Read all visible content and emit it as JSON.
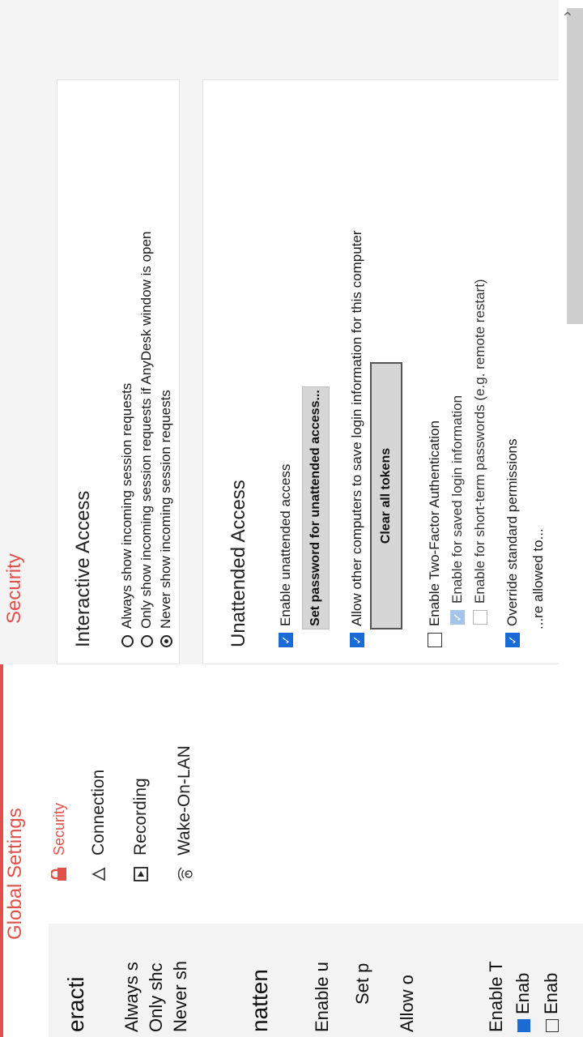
{
  "background": {
    "left_rows": [
      "eracti",
      "Always s",
      "Only shc",
      "Never sh",
      "natten",
      "Enable u",
      "Set p",
      "Allow o",
      "Enable T",
      "Enab",
      "Enab"
    ]
  },
  "header": {
    "app_title": "Global Settings",
    "page_title": "Security"
  },
  "sidebar": {
    "items": [
      {
        "label": "Security",
        "icon": "lock-icon",
        "active": true
      },
      {
        "label": "Connection",
        "icon": "connection-icon",
        "active": false
      },
      {
        "label": "Recording",
        "icon": "recording-icon",
        "active": false
      },
      {
        "label": "Wake-On-LAN",
        "icon": "wake-on-lan-icon",
        "active": false
      }
    ]
  },
  "interactive_access": {
    "title": "Interactive Access",
    "options": [
      {
        "label": "Always show incoming session requests",
        "selected": false
      },
      {
        "label": "Only show incoming session requests if AnyDesk window is open",
        "selected": false
      },
      {
        "label": "Never show incoming session requests",
        "selected": true
      }
    ]
  },
  "unattended_access": {
    "title": "Unattended Access",
    "enable_label": "Enable unattended access",
    "set_password_label": "Set password for unattended access...",
    "allow_save_label": "Allow other computers to save login information for this computer",
    "clear_tokens_label": "Clear all tokens",
    "two_factor_label": "Enable Two-Factor Authentication",
    "saved_login_label": "Enable for saved login information",
    "short_term_label": "Enable for short-term passwords (e.g. remote restart)",
    "override_label": "Override standard permissions",
    "allowed_to_label": "...re allowed to..."
  },
  "colors": {
    "accent": "#e2504a",
    "checkbox_blue": "#1b6bd6"
  }
}
